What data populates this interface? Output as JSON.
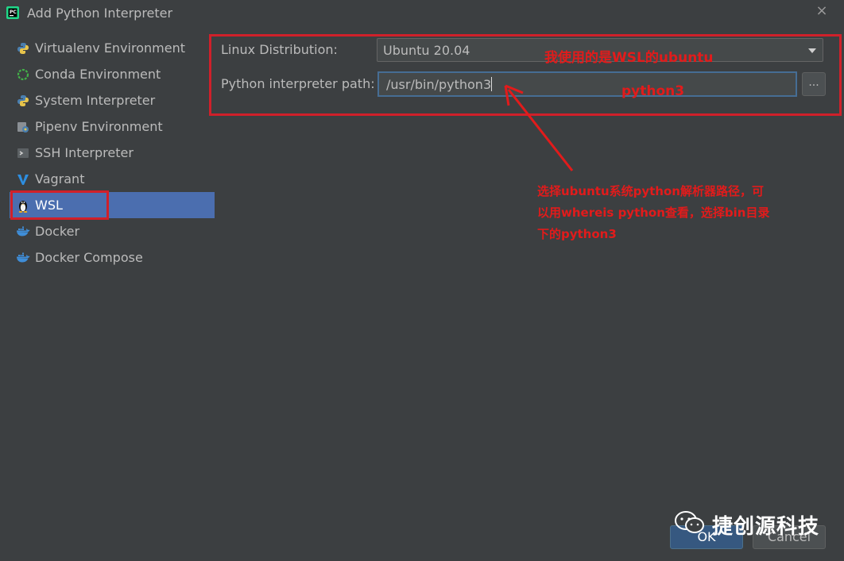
{
  "window": {
    "title": "Add Python Interpreter",
    "close_glyph": "×",
    "app_icon": "pycharm-icon"
  },
  "sidebar": {
    "items": [
      {
        "label": "Virtualenv Environment",
        "icon": "python-icon"
      },
      {
        "label": "Conda Environment",
        "icon": "conda-icon"
      },
      {
        "label": "System Interpreter",
        "icon": "python-icon"
      },
      {
        "label": "Pipenv Environment",
        "icon": "pipenv-icon"
      },
      {
        "label": "SSH Interpreter",
        "icon": "terminal-icon"
      },
      {
        "label": "Vagrant",
        "icon": "vagrant-icon"
      },
      {
        "label": "WSL",
        "icon": "linux-penguin-icon",
        "selected": true
      },
      {
        "label": "Docker",
        "icon": "docker-icon"
      },
      {
        "label": "Docker Compose",
        "icon": "docker-icon"
      }
    ]
  },
  "form": {
    "distribution_label": "Linux Distribution:",
    "distribution_value": "Ubuntu 20.04",
    "path_label": "Python interpreter path:",
    "path_value": "/usr/bin/python3",
    "browse_label": "..."
  },
  "annotations": {
    "wsl_note": "我使用的是WSL的ubuntu",
    "python3_note": "python3",
    "path_note_lines": [
      "选择ubuntu系统python解析器路径，可",
      "以用whereis python查看，选择bin目录",
      "下的python3"
    ],
    "accent_color": "#e21b1b"
  },
  "buttons": {
    "ok": "OK",
    "cancel": "Cancel"
  },
  "watermark": {
    "text": "捷创源科技",
    "icon": "wechat-icon"
  },
  "colors": {
    "background": "#3c3f41",
    "selection": "#4b6eaf",
    "text": "#bbbbbb"
  }
}
